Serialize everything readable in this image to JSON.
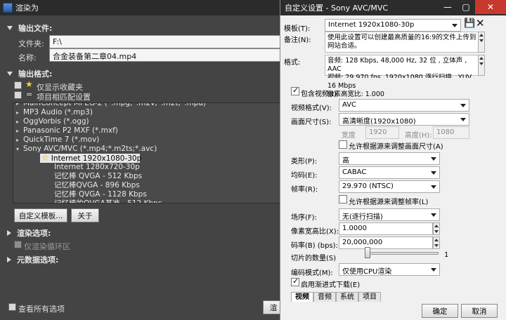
{
  "render": {
    "title": "渲染为",
    "output_file_heading": "输出文件:",
    "folder_label": "文件夹:",
    "folder_value": "F:\\",
    "name_label": "名称:",
    "name_value": "合金装备第二章04.mp4",
    "output_format_heading": "输出格式:",
    "show_favorites_label": "仅显示收藏夹",
    "match_project_label": "项目相匹配设置",
    "tree": [
      {
        "text": "MainConcept MPEG-2 (*.mpg;*.m2v;*.m2t;*.mpa)",
        "indent": 0,
        "expander": "▸"
      },
      {
        "text": "MP3 Audio (*.mp3)",
        "indent": 0,
        "expander": "▸"
      },
      {
        "text": "OggVorbis (*.ogg)",
        "indent": 0,
        "expander": "▸"
      },
      {
        "text": "Panasonic P2 MXF (*.mxf)",
        "indent": 0,
        "expander": "▸"
      },
      {
        "text": "QuickTime 7 (*.mov)",
        "indent": 0,
        "expander": "▸"
      },
      {
        "text": "Sony AVC/MVC (*.mp4;*.m2ts;*.avc)",
        "indent": 0,
        "expander": "▾"
      },
      {
        "text": "Internet 1920x1080-30p",
        "indent": 1,
        "star": true,
        "selected": true
      },
      {
        "text": "Internet 1280x720-30p",
        "indent": 1,
        "star": false
      },
      {
        "text": "记忆棒 QVGA - 512 Kbps",
        "indent": 1,
        "star": false
      },
      {
        "text": "记忆棒QVGA - 896 Kbps",
        "indent": 1,
        "star": false
      },
      {
        "text": "记忆棒 QVGA - 1128 Kbps",
        "indent": 1,
        "star": false
      },
      {
        "text": "记忆棒的QVGA基准 - 512 Kbps",
        "indent": 1,
        "star": false
      }
    ],
    "customize_button": "自定义模板...",
    "about_button": "关于",
    "render_options_heading": "渲染选项:",
    "loop_region_label": "仅渲染循环区",
    "metadata_heading": "元数据选项:",
    "show_all_label": "查看所有选项",
    "bottom_button": "渲"
  },
  "dialog": {
    "title": "自定义设置 - Sony AVC/MVC",
    "template_label": "模板(T):",
    "template_value": "Internet 1920x1080-30p",
    "note_label": "备注(N):",
    "note_text": "使用此设置可以创建最高质量的16:9的文件上传到网站合适。",
    "format_label": "格式:",
    "format_lines": [
      "音频:    128 Kbps, 48,000 Hz, 32 位 , 立体声 , AAC",
      "视频:    29.970 fps, 1920x1080 逐行扫描 , YUV, 16 Mbps",
      "像素高宽比: 1.000"
    ],
    "include_video_label": "包含视频(I)",
    "video_format_label": "视频格式(V):",
    "video_format_value": "AVC",
    "frame_size_label": "画面尺寸(S):",
    "frame_size_value": "高清晰度(1920x1080)",
    "width_label": "宽度",
    "width_value": "1920",
    "height_label": "高度(H):",
    "height_value": "1080",
    "allow_frame_size_label": "允许根据源来调整画面尺寸(A)",
    "profile_label": "类形(P):",
    "profile_value": "高",
    "entropy_label": "均码(E):",
    "entropy_value": "CABAC",
    "frame_rate_label": "帧率(R):",
    "frame_rate_value": "29.970 (NTSC)",
    "allow_frame_rate_label": "允许根据源来调整帧率(L)",
    "field_order_label": "场序(F):",
    "field_order_value": "无(逐行扫描)",
    "par_label": "像素宽高比(X):",
    "par_value": "1.0000",
    "bitrate_label": "码率(B) (bps):",
    "bitrate_value": "20,000,000",
    "slices_label": "切片的数量(S)",
    "slices_value": "1",
    "encode_mode_label": "编码模式(M):",
    "encode_mode_value": "仅使用CPU渲染",
    "progressive_download_label": "启用渐进式下载(E)",
    "tabs": [
      "视频",
      "音频",
      "系统",
      "项目"
    ],
    "ok_button": "确定",
    "cancel_button": "取消"
  }
}
